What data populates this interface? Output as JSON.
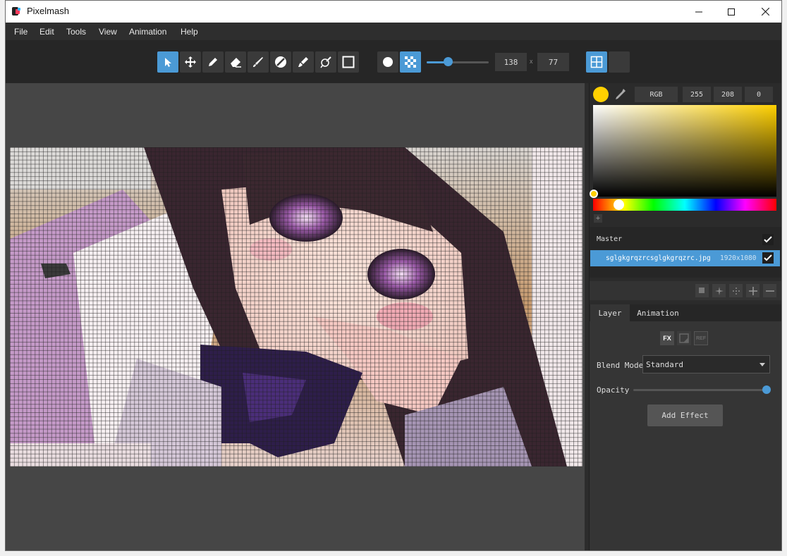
{
  "app": {
    "title": "Pixelmash"
  },
  "menu": [
    "File",
    "Edit",
    "Tools",
    "View",
    "Animation",
    "Help"
  ],
  "toolbar": {
    "tools": [
      "pointer-icon",
      "move-icon",
      "pencil-icon",
      "eraser-icon",
      "brush-icon",
      "fill-icon",
      "paint-icon",
      "pen-icon",
      "rectangle-icon"
    ],
    "active_tool": "pointer-icon",
    "shape_modes": [
      "circle-brush-icon",
      "dither-pattern-icon"
    ],
    "active_shape": "dither-pattern-icon",
    "pixel_size_value": 0.3,
    "width": "138",
    "x_sep": "x",
    "height": "77",
    "view_toggles": [
      "grid-view-icon",
      "blank-view-icon"
    ],
    "accent_color": "#4b9ad6"
  },
  "color": {
    "current": "#ffd000",
    "mode": "RGB",
    "r": "255",
    "g": "208",
    "b": "0",
    "add_swatch": "+"
  },
  "layers": {
    "master_label": "Master",
    "master_checked": true,
    "items": [
      {
        "name": "sglgkgrqzrcsglgkgrqzrc.jpg",
        "size": "1920x1080",
        "checked": true
      }
    ]
  },
  "layer_tools": [
    "duplicate-icon",
    "sparkle-icon",
    "dots-icon",
    "add-icon",
    "remove-icon"
  ],
  "tabs": {
    "items": [
      "Layer",
      "Animation"
    ],
    "active": "Layer"
  },
  "props": {
    "fx_buttons": [
      "FX",
      "",
      "REF"
    ],
    "blend_label": "Blend Mode",
    "blend_value": "Standard",
    "opacity_label": "Opacity",
    "opacity_value": 1.0,
    "add_effect_label": "Add Effect"
  }
}
